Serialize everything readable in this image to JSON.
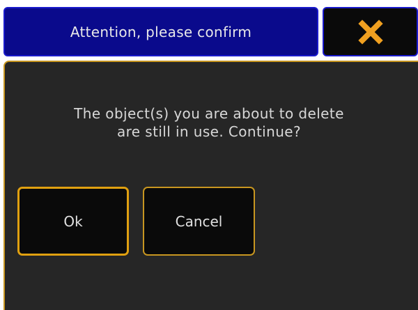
{
  "dialog": {
    "title": "Attention, please confirm",
    "close_icon": "close-x-icon",
    "message_line1": "The object(s) you are about to delete",
    "message_line2": "are still in use. Continue?",
    "ok_label": "Ok",
    "cancel_label": "Cancel"
  },
  "colors": {
    "title_bg": "#0a0a8c",
    "title_border": "#1a1acc",
    "panel_bg": "#262626",
    "accent": "#e0a010",
    "close_icon": "#f0a020",
    "text": "#d8d8d8"
  }
}
